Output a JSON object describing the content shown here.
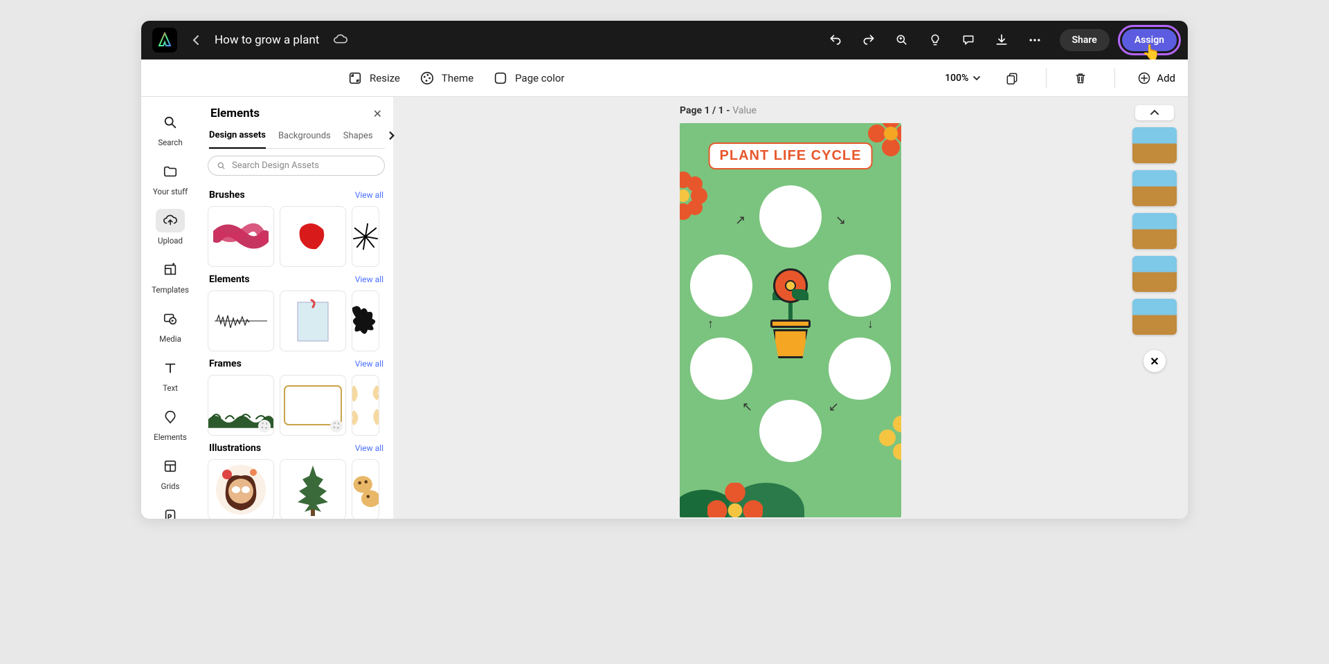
{
  "header": {
    "title": "How to grow a plant",
    "share": "Share",
    "assign": "Assign"
  },
  "toolbar": {
    "resize": "Resize",
    "theme": "Theme",
    "page_color": "Page color",
    "zoom": "100%",
    "add": "Add"
  },
  "rail": {
    "search": "Search",
    "your_stuff": "Your stuff",
    "upload": "Upload",
    "templates": "Templates",
    "media": "Media",
    "text": "Text",
    "elements": "Elements",
    "grids": "Grids"
  },
  "panel": {
    "title": "Elements",
    "tabs": {
      "design_assets": "Design assets",
      "backgrounds": "Backgrounds",
      "shapes": "Shapes"
    },
    "search_placeholder": "Search Design Assets",
    "view_all": "View all",
    "sections": {
      "brushes": "Brushes",
      "elements": "Elements",
      "frames": "Frames",
      "illustrations": "Illustrations"
    }
  },
  "canvas": {
    "page_label_prefix": "Page 1 / 1 - ",
    "page_label_value": "Value",
    "artwork_title": "PLANT LIFE CYCLE"
  }
}
